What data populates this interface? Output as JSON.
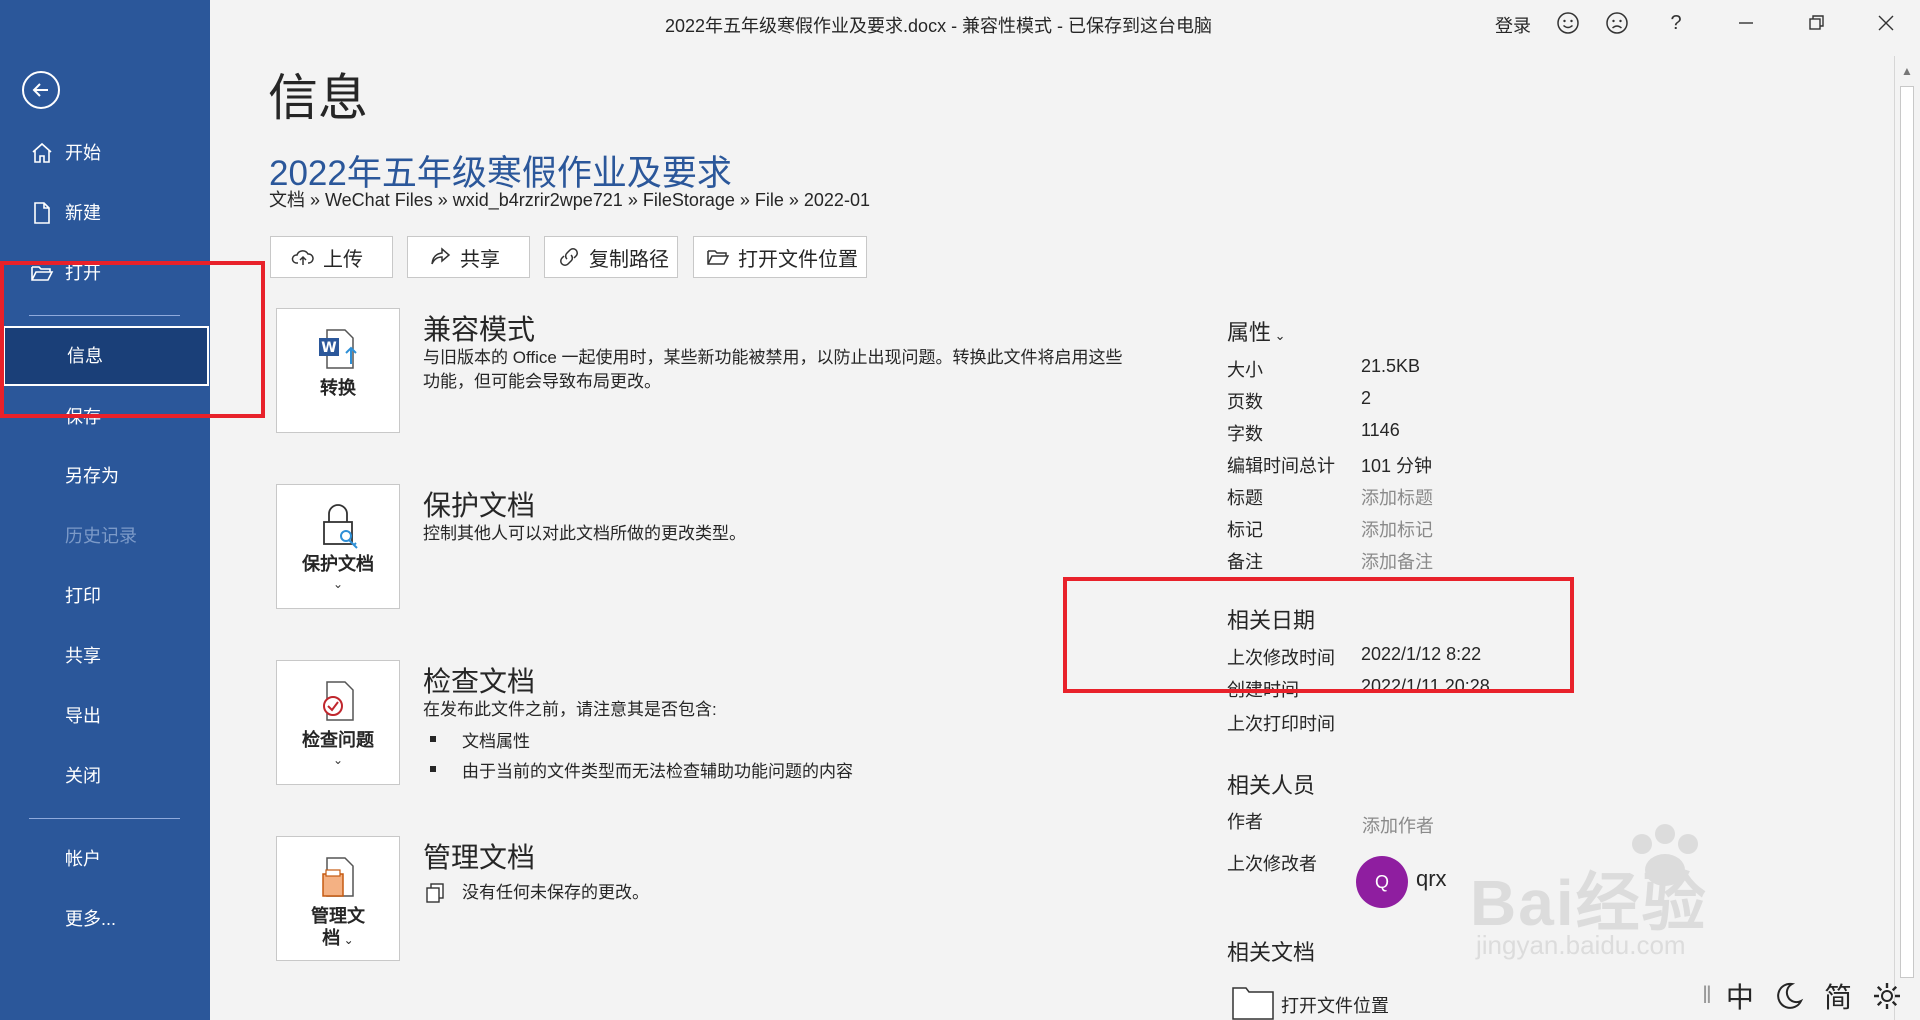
{
  "window": {
    "title": "2022年五年级寒假作业及要求.docx - 兼容性模式 - 已保存到这台电脑",
    "login": "登录"
  },
  "sidebar": {
    "items": [
      {
        "label": "开始"
      },
      {
        "label": "新建"
      },
      {
        "label": "打开"
      },
      {
        "label": "信息"
      },
      {
        "label": "保存"
      },
      {
        "label": "另存为"
      },
      {
        "label": "历史记录"
      },
      {
        "label": "打印"
      },
      {
        "label": "共享"
      },
      {
        "label": "导出"
      },
      {
        "label": "关闭"
      },
      {
        "label": "帐户"
      },
      {
        "label": "更多..."
      }
    ]
  },
  "main": {
    "page_title": "信息",
    "doc_title": "2022年五年级寒假作业及要求",
    "breadcrumb": "文档 » WeChat Files » wxid_b4rzrir2wpe721 » FileStorage » File » 2022-01",
    "actions": {
      "upload": "上传",
      "share": "共享",
      "copy_path": "复制路径",
      "open_location": "打开文件位置"
    },
    "sections": {
      "compat": {
        "button": "转换",
        "title": "兼容模式",
        "desc": "与旧版本的 Office 一起使用时，某些新功能被禁用，以防止出现问题。转换此文件将启用这些功能，但可能会导致布局更改。"
      },
      "protect": {
        "button": "保护文档",
        "title": "保护文档",
        "desc": "控制其他人可以对此文档所做的更改类型。"
      },
      "inspect": {
        "button": "检查问题",
        "title": "检查文档",
        "desc": "在发布此文件之前，请注意其是否包含:",
        "bullets": [
          "文档属性",
          "由于当前的文件类型而无法检查辅助功能问题的内容"
        ]
      },
      "manage": {
        "button_line1": "管理文",
        "button_line2": "档",
        "title": "管理文档",
        "desc": "没有任何未保存的更改。"
      }
    }
  },
  "properties": {
    "heading": "属性",
    "rows": [
      {
        "label": "大小",
        "value": "21.5KB"
      },
      {
        "label": "页数",
        "value": "2"
      },
      {
        "label": "字数",
        "value": "1146"
      },
      {
        "label": "编辑时间总计",
        "value": "101 分钟"
      },
      {
        "label": "标题",
        "value": "添加标题"
      },
      {
        "label": "标记",
        "value": "添加标记"
      },
      {
        "label": "备注",
        "value": "添加备注"
      }
    ],
    "dates_heading": "相关日期",
    "dates": [
      {
        "label": "上次修改时间",
        "value": "2022/1/12 8:22"
      },
      {
        "label": "创建时间",
        "value": "2022/1/11 20:28"
      },
      {
        "label": "上次打印时间",
        "value": ""
      }
    ],
    "people_heading": "相关人员",
    "author_label": "作者",
    "author_value": "添加作者",
    "last_modified_by_label": "上次修改者",
    "avatar_initial": "Q",
    "last_modified_by": "qrx",
    "docs_heading": "相关文档",
    "open_location": "打开文件位置"
  },
  "watermark": {
    "text": "Bai经验",
    "url": "jingyan.baidu.com"
  },
  "ime": {
    "lang": "中",
    "mode": "简"
  },
  "colors": {
    "sidebar": "#2b579a",
    "active": "#1a3f78",
    "accent": "#2b579a",
    "highlight": "#e8212a",
    "avatar": "#8f1ea0"
  }
}
